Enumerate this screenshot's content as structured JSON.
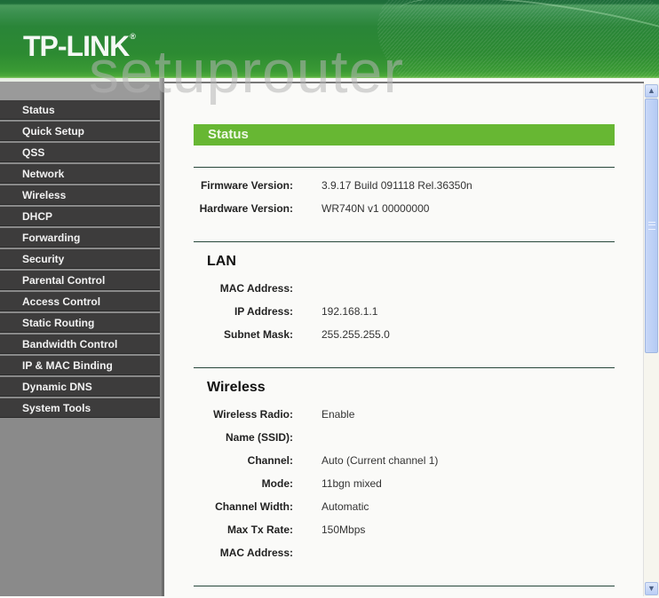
{
  "header": {
    "logo_text": "TP-LINK",
    "logo_mark": "®",
    "watermark": "setuprouter"
  },
  "sidebar": {
    "items": [
      {
        "label": "Status"
      },
      {
        "label": "Quick Setup"
      },
      {
        "label": "QSS"
      },
      {
        "label": "Network"
      },
      {
        "label": "Wireless"
      },
      {
        "label": "DHCP"
      },
      {
        "label": "Forwarding"
      },
      {
        "label": "Security"
      },
      {
        "label": "Parental Control"
      },
      {
        "label": "Access Control"
      },
      {
        "label": "Static Routing"
      },
      {
        "label": "Bandwidth Control"
      },
      {
        "label": "IP & MAC Binding"
      },
      {
        "label": "Dynamic DNS"
      },
      {
        "label": "System Tools"
      }
    ]
  },
  "main": {
    "title": "Status",
    "version": {
      "firmware_label": "Firmware Version:",
      "firmware_value": "3.9.17 Build 091118 Rel.36350n",
      "hardware_label": "Hardware Version:",
      "hardware_value": "WR740N v1 00000000"
    },
    "lan": {
      "title": "LAN",
      "rows": [
        {
          "label": "MAC Address:",
          "value": ""
        },
        {
          "label": "IP Address:",
          "value": "192.168.1.1"
        },
        {
          "label": "Subnet Mask:",
          "value": "255.255.255.0"
        }
      ]
    },
    "wireless": {
      "title": "Wireless",
      "rows": [
        {
          "label": "Wireless Radio:",
          "value": "Enable"
        },
        {
          "label": "Name (SSID):",
          "value": ""
        },
        {
          "label": "Channel:",
          "value": "Auto (Current channel 1)"
        },
        {
          "label": "Mode:",
          "value": "11bgn mixed"
        },
        {
          "label": "Channel Width:",
          "value": "Automatic"
        },
        {
          "label": "Max Tx Rate:",
          "value": "150Mbps"
        },
        {
          "label": "MAC Address:",
          "value": ""
        }
      ]
    }
  },
  "scrollbar": {
    "up_icon": "▲",
    "down_icon": "▼",
    "scroll_position_fraction": 0.0,
    "visible_fraction": 0.52
  },
  "colors": {
    "brand_green": "#2c8a32",
    "title_bar": "#67b733",
    "nav_item_bg": "#3d3c3c",
    "sidebar_bg": "#8a8a8a"
  }
}
